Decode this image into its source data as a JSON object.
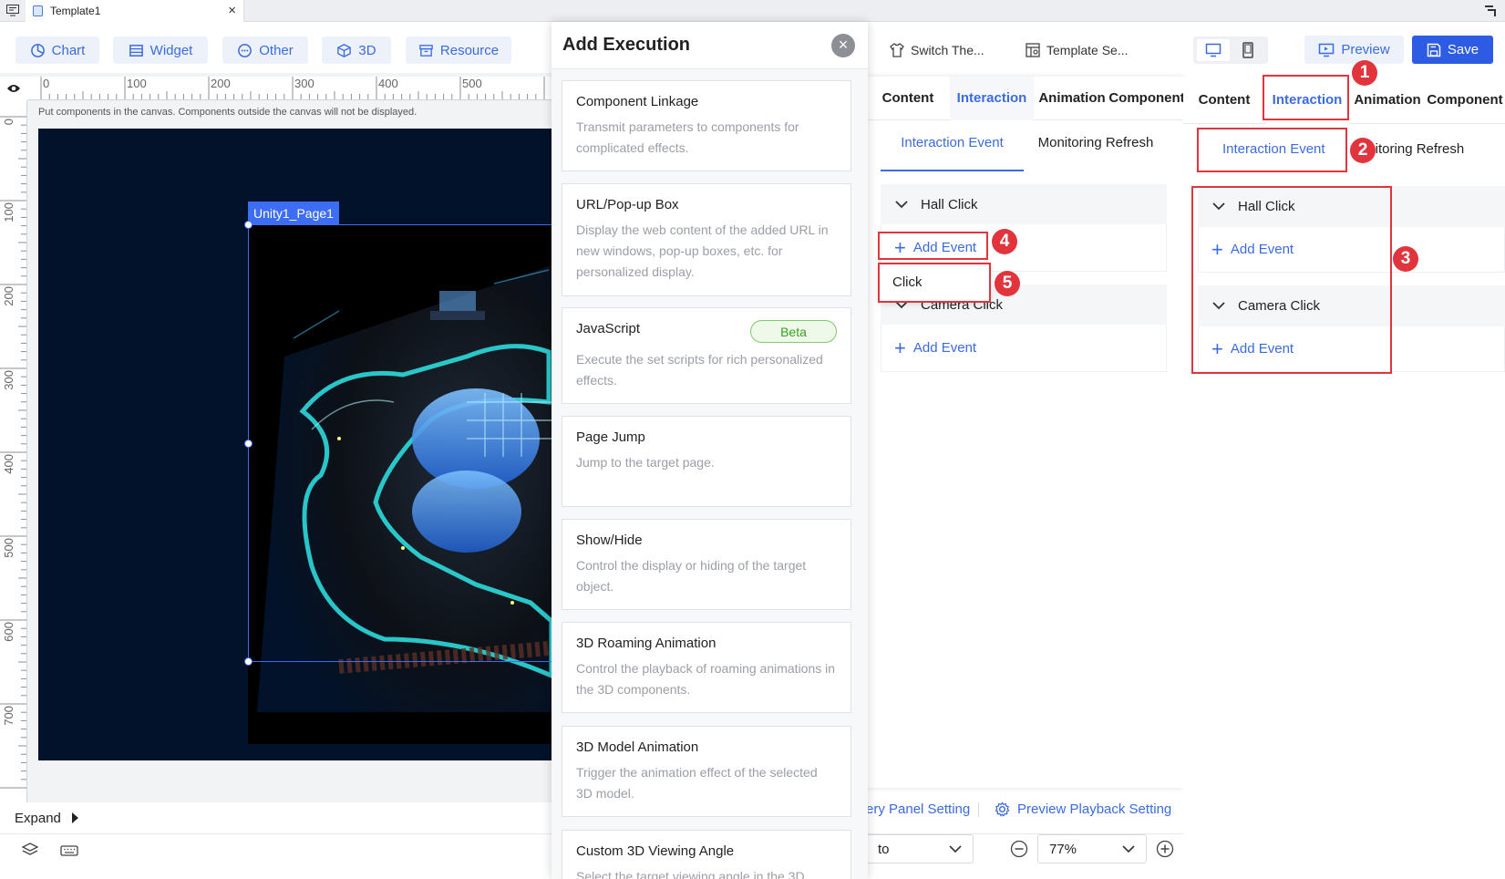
{
  "window": {
    "tab_title": "Template1"
  },
  "toolbar": {
    "chart": "Chart",
    "widget": "Widget",
    "other": "Other",
    "threed": "3D",
    "resource": "Resource",
    "switch_theme": "Switch The...",
    "template_settings": "Template Se...",
    "preview": "Preview",
    "save": "Save"
  },
  "canvas": {
    "hint": "Put components in the canvas. Components outside the canvas will not be displayed.",
    "selection_label": "Unity1_Page1",
    "ruler_h": [
      "0",
      "100",
      "200",
      "300",
      "400",
      "500"
    ],
    "ruler_v": [
      "0",
      "100",
      "200",
      "300",
      "400",
      "500",
      "600",
      "700"
    ]
  },
  "bottom": {
    "expand": "Expand",
    "query_panel": "ery Panel Setting",
    "playback_setting": "Preview Playback Setting",
    "fit_select": "to",
    "zoom": "77%"
  },
  "modal": {
    "title": "Add Execution",
    "cards": [
      {
        "title": "Component Linkage",
        "desc": "Transmit parameters to components for complicated effects."
      },
      {
        "title": "URL/Pop-up Box",
        "desc": "Display the web content of the added URL in new windows, pop-up boxes, etc. for personalized display."
      },
      {
        "title": "JavaScript",
        "desc": "Execute the set scripts for rich personalized effects.",
        "badge": "Beta"
      },
      {
        "title": "Page Jump",
        "desc": "Jump to the target page."
      },
      {
        "title": "Show/Hide",
        "desc": "Control the display or hiding of the target object."
      },
      {
        "title": "3D Roaming Animation",
        "desc": "Control the playback of roaming animations in the 3D components."
      },
      {
        "title": "3D Model Animation",
        "desc": "Trigger the animation effect of the selected 3D model."
      },
      {
        "title": "Custom 3D Viewing Angle",
        "desc": "Select the target viewing angle in the 3D"
      }
    ]
  },
  "panel": {
    "tabs": [
      "Content",
      "Interaction",
      "Animation",
      "Component"
    ],
    "subtabs": [
      "Interaction Event",
      "Monitoring Refresh"
    ],
    "subtab_cut": "onitoring Refresh",
    "groups": [
      {
        "name": "Hall Click",
        "action": "Add Event"
      },
      {
        "name": "Camera Click",
        "action": "Add Event"
      }
    ],
    "dropdown_item": "Click"
  },
  "annotations": [
    "1",
    "2",
    "3",
    "4",
    "5"
  ],
  "colors": {
    "accent": "#3b6be0",
    "save": "#2d5be3",
    "annotation": "#e1343c",
    "canvas_bg": "#02122a"
  }
}
